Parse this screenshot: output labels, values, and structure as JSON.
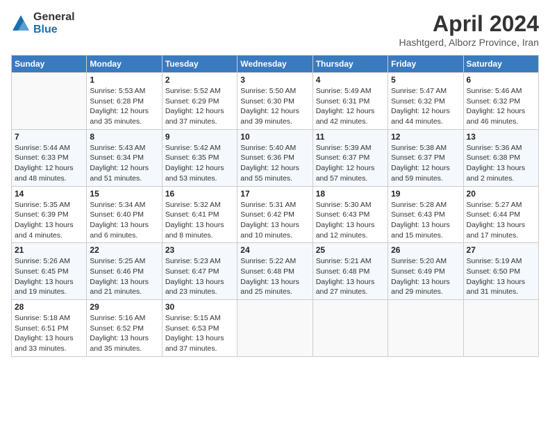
{
  "logo": {
    "general": "General",
    "blue": "Blue"
  },
  "title": "April 2024",
  "subtitle": "Hashtgerd, Alborz Province, Iran",
  "weekdays": [
    "Sunday",
    "Monday",
    "Tuesday",
    "Wednesday",
    "Thursday",
    "Friday",
    "Saturday"
  ],
  "weeks": [
    [
      {
        "day": "",
        "sunrise": "",
        "sunset": "",
        "daylight": ""
      },
      {
        "day": "1",
        "sunrise": "Sunrise: 5:53 AM",
        "sunset": "Sunset: 6:28 PM",
        "daylight": "Daylight: 12 hours and 35 minutes."
      },
      {
        "day": "2",
        "sunrise": "Sunrise: 5:52 AM",
        "sunset": "Sunset: 6:29 PM",
        "daylight": "Daylight: 12 hours and 37 minutes."
      },
      {
        "day": "3",
        "sunrise": "Sunrise: 5:50 AM",
        "sunset": "Sunset: 6:30 PM",
        "daylight": "Daylight: 12 hours and 39 minutes."
      },
      {
        "day": "4",
        "sunrise": "Sunrise: 5:49 AM",
        "sunset": "Sunset: 6:31 PM",
        "daylight": "Daylight: 12 hours and 42 minutes."
      },
      {
        "day": "5",
        "sunrise": "Sunrise: 5:47 AM",
        "sunset": "Sunset: 6:32 PM",
        "daylight": "Daylight: 12 hours and 44 minutes."
      },
      {
        "day": "6",
        "sunrise": "Sunrise: 5:46 AM",
        "sunset": "Sunset: 6:32 PM",
        "daylight": "Daylight: 12 hours and 46 minutes."
      }
    ],
    [
      {
        "day": "7",
        "sunrise": "Sunrise: 5:44 AM",
        "sunset": "Sunset: 6:33 PM",
        "daylight": "Daylight: 12 hours and 48 minutes."
      },
      {
        "day": "8",
        "sunrise": "Sunrise: 5:43 AM",
        "sunset": "Sunset: 6:34 PM",
        "daylight": "Daylight: 12 hours and 51 minutes."
      },
      {
        "day": "9",
        "sunrise": "Sunrise: 5:42 AM",
        "sunset": "Sunset: 6:35 PM",
        "daylight": "Daylight: 12 hours and 53 minutes."
      },
      {
        "day": "10",
        "sunrise": "Sunrise: 5:40 AM",
        "sunset": "Sunset: 6:36 PM",
        "daylight": "Daylight: 12 hours and 55 minutes."
      },
      {
        "day": "11",
        "sunrise": "Sunrise: 5:39 AM",
        "sunset": "Sunset: 6:37 PM",
        "daylight": "Daylight: 12 hours and 57 minutes."
      },
      {
        "day": "12",
        "sunrise": "Sunrise: 5:38 AM",
        "sunset": "Sunset: 6:37 PM",
        "daylight": "Daylight: 12 hours and 59 minutes."
      },
      {
        "day": "13",
        "sunrise": "Sunrise: 5:36 AM",
        "sunset": "Sunset: 6:38 PM",
        "daylight": "Daylight: 13 hours and 2 minutes."
      }
    ],
    [
      {
        "day": "14",
        "sunrise": "Sunrise: 5:35 AM",
        "sunset": "Sunset: 6:39 PM",
        "daylight": "Daylight: 13 hours and 4 minutes."
      },
      {
        "day": "15",
        "sunrise": "Sunrise: 5:34 AM",
        "sunset": "Sunset: 6:40 PM",
        "daylight": "Daylight: 13 hours and 6 minutes."
      },
      {
        "day": "16",
        "sunrise": "Sunrise: 5:32 AM",
        "sunset": "Sunset: 6:41 PM",
        "daylight": "Daylight: 13 hours and 8 minutes."
      },
      {
        "day": "17",
        "sunrise": "Sunrise: 5:31 AM",
        "sunset": "Sunset: 6:42 PM",
        "daylight": "Daylight: 13 hours and 10 minutes."
      },
      {
        "day": "18",
        "sunrise": "Sunrise: 5:30 AM",
        "sunset": "Sunset: 6:43 PM",
        "daylight": "Daylight: 13 hours and 12 minutes."
      },
      {
        "day": "19",
        "sunrise": "Sunrise: 5:28 AM",
        "sunset": "Sunset: 6:43 PM",
        "daylight": "Daylight: 13 hours and 15 minutes."
      },
      {
        "day": "20",
        "sunrise": "Sunrise: 5:27 AM",
        "sunset": "Sunset: 6:44 PM",
        "daylight": "Daylight: 13 hours and 17 minutes."
      }
    ],
    [
      {
        "day": "21",
        "sunrise": "Sunrise: 5:26 AM",
        "sunset": "Sunset: 6:45 PM",
        "daylight": "Daylight: 13 hours and 19 minutes."
      },
      {
        "day": "22",
        "sunrise": "Sunrise: 5:25 AM",
        "sunset": "Sunset: 6:46 PM",
        "daylight": "Daylight: 13 hours and 21 minutes."
      },
      {
        "day": "23",
        "sunrise": "Sunrise: 5:23 AM",
        "sunset": "Sunset: 6:47 PM",
        "daylight": "Daylight: 13 hours and 23 minutes."
      },
      {
        "day": "24",
        "sunrise": "Sunrise: 5:22 AM",
        "sunset": "Sunset: 6:48 PM",
        "daylight": "Daylight: 13 hours and 25 minutes."
      },
      {
        "day": "25",
        "sunrise": "Sunrise: 5:21 AM",
        "sunset": "Sunset: 6:48 PM",
        "daylight": "Daylight: 13 hours and 27 minutes."
      },
      {
        "day": "26",
        "sunrise": "Sunrise: 5:20 AM",
        "sunset": "Sunset: 6:49 PM",
        "daylight": "Daylight: 13 hours and 29 minutes."
      },
      {
        "day": "27",
        "sunrise": "Sunrise: 5:19 AM",
        "sunset": "Sunset: 6:50 PM",
        "daylight": "Daylight: 13 hours and 31 minutes."
      }
    ],
    [
      {
        "day": "28",
        "sunrise": "Sunrise: 5:18 AM",
        "sunset": "Sunset: 6:51 PM",
        "daylight": "Daylight: 13 hours and 33 minutes."
      },
      {
        "day": "29",
        "sunrise": "Sunrise: 5:16 AM",
        "sunset": "Sunset: 6:52 PM",
        "daylight": "Daylight: 13 hours and 35 minutes."
      },
      {
        "day": "30",
        "sunrise": "Sunrise: 5:15 AM",
        "sunset": "Sunset: 6:53 PM",
        "daylight": "Daylight: 13 hours and 37 minutes."
      },
      {
        "day": "",
        "sunrise": "",
        "sunset": "",
        "daylight": ""
      },
      {
        "day": "",
        "sunrise": "",
        "sunset": "",
        "daylight": ""
      },
      {
        "day": "",
        "sunrise": "",
        "sunset": "",
        "daylight": ""
      },
      {
        "day": "",
        "sunrise": "",
        "sunset": "",
        "daylight": ""
      }
    ]
  ]
}
